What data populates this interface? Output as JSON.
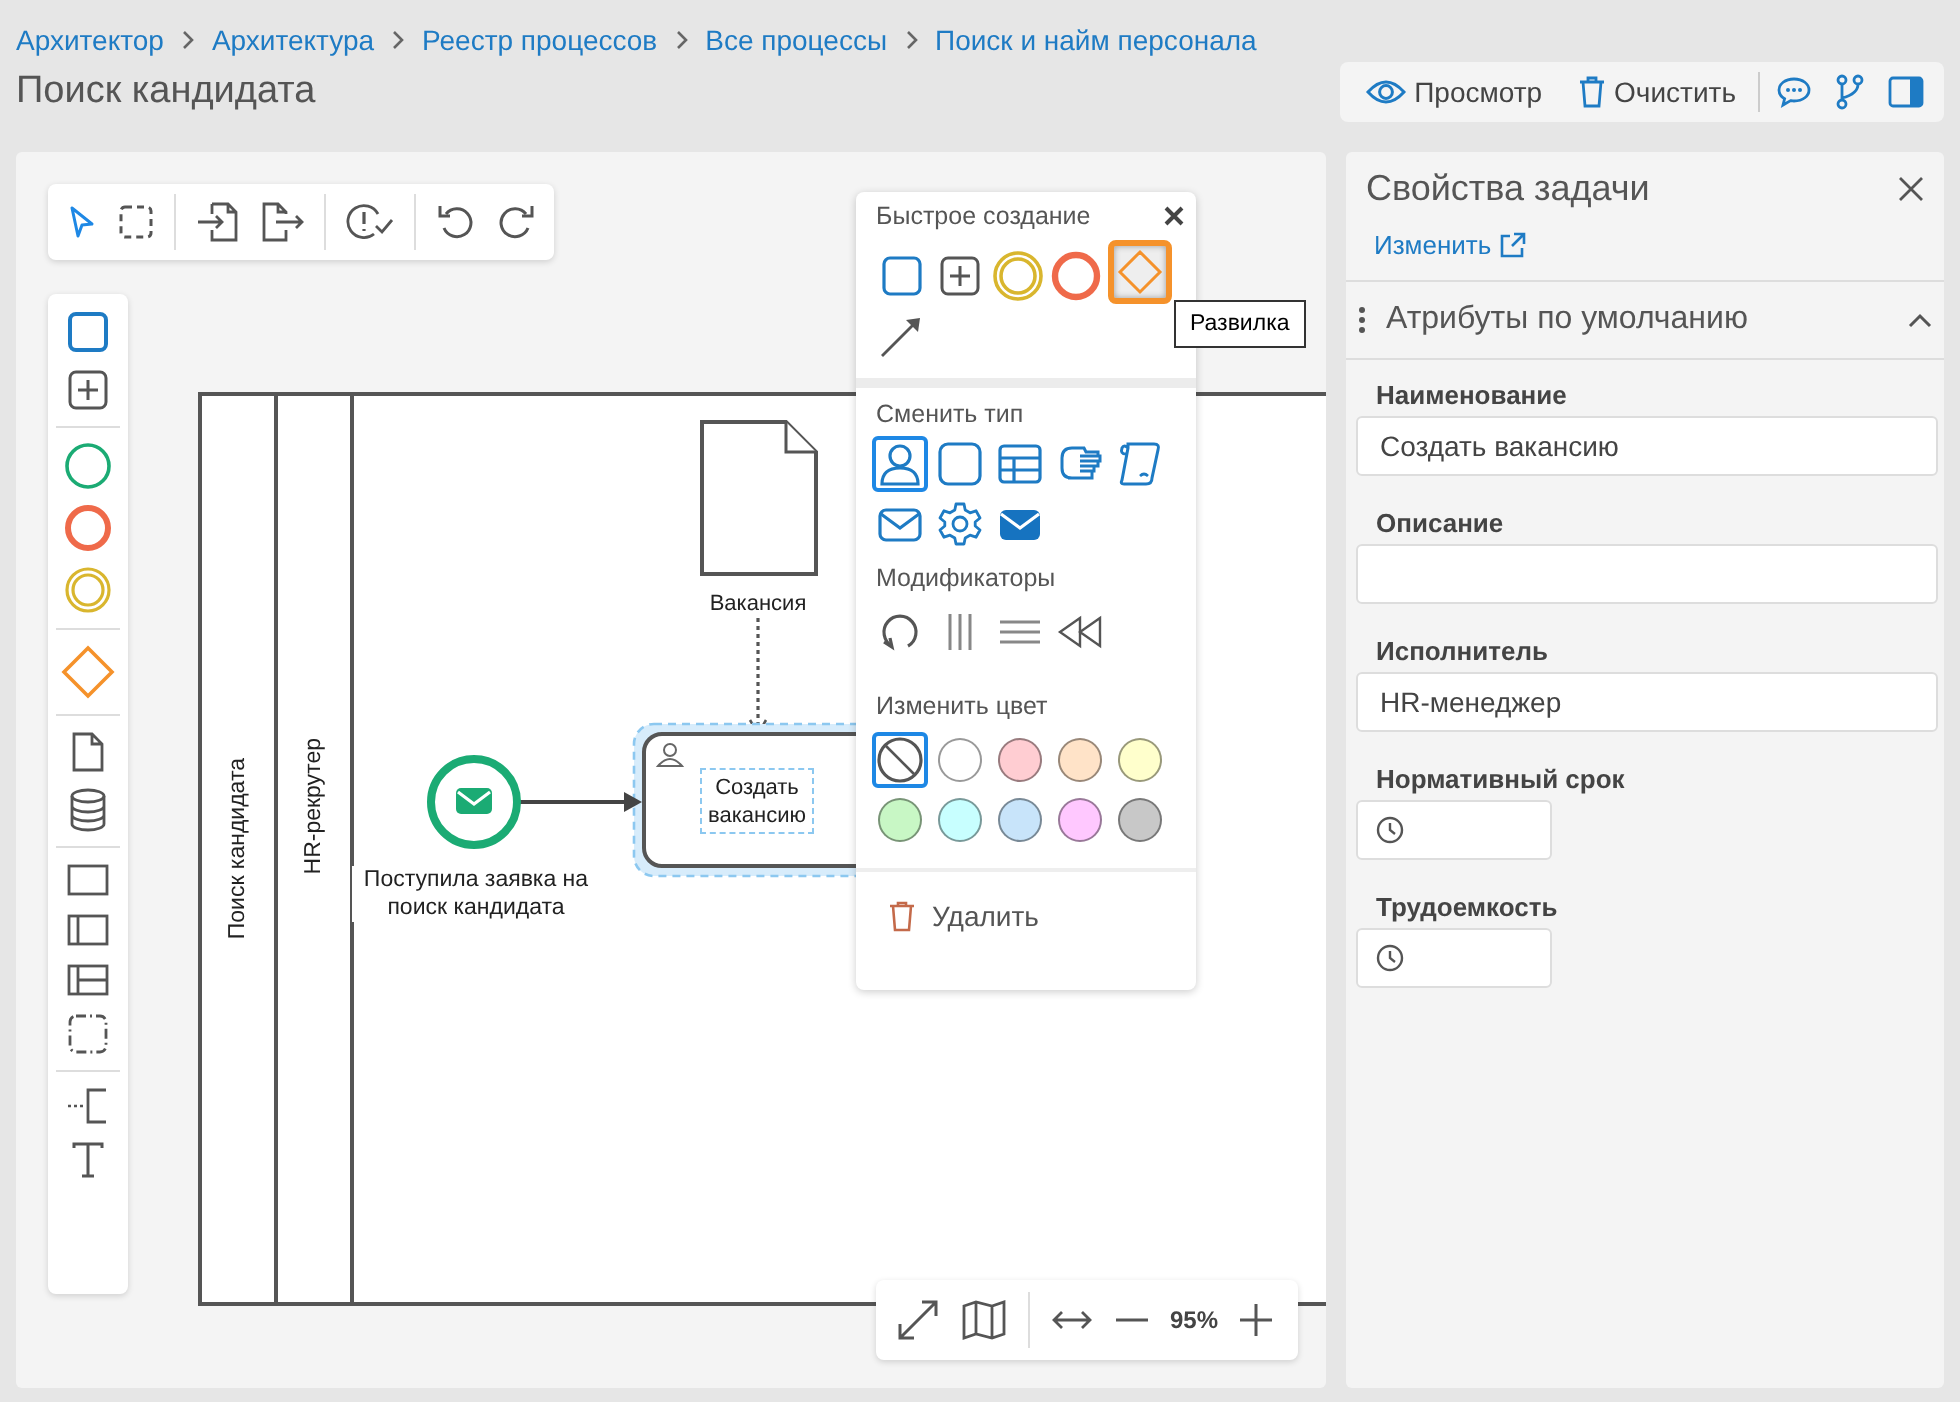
{
  "breadcrumbs": [
    "Архитектор",
    "Архитектура",
    "Реестр процессов",
    "Все процессы",
    "Поиск и найм персонала"
  ],
  "title": "Поиск кандидата",
  "header_actions": [
    {
      "kind": "view",
      "label": "Просмотр"
    },
    {
      "kind": "clear",
      "label": "Очистить"
    },
    {
      "kind": "comments"
    },
    {
      "kind": "branches"
    },
    {
      "kind": "panel"
    }
  ],
  "diagram": {
    "lanes": [
      "Поиск кандидата",
      "HR-рекрутер"
    ],
    "start_event": {
      "label": "Поступила заявка на поиск кандидата"
    },
    "data_object": {
      "label": "Вакансия"
    },
    "task": {
      "label": "Создать вакансию",
      "selected": true
    }
  },
  "quick_menu": {
    "title": "Быстрое создание",
    "create_items": [
      {
        "kind": "task",
        "selected": false
      },
      {
        "kind": "subprocess",
        "selected": false
      },
      {
        "kind": "intermediate",
        "selected": false
      },
      {
        "kind": "end",
        "selected": false
      },
      {
        "kind": "gateway",
        "selected": true
      },
      {
        "kind": "connector",
        "selected": false
      }
    ],
    "tooltip": "Развилка",
    "type_title": "Сменить тип",
    "types": [
      {
        "kind": "user",
        "selected": true
      },
      {
        "kind": "plain",
        "selected": false
      },
      {
        "kind": "rule",
        "selected": false
      },
      {
        "kind": "manual",
        "selected": false
      },
      {
        "kind": "script",
        "selected": false
      },
      {
        "kind": "receive",
        "selected": false
      },
      {
        "kind": "service",
        "selected": false
      },
      {
        "kind": "send",
        "selected": false
      }
    ],
    "modifiers_title": "Модификаторы",
    "modifiers": [
      {
        "kind": "loop"
      },
      {
        "kind": "parallel"
      },
      {
        "kind": "sequential"
      },
      {
        "kind": "compensation"
      }
    ],
    "color_title": "Изменить цвет",
    "colors": [
      {
        "kind": "none",
        "selected": true
      },
      {
        "kind": "fill",
        "color": "#ffffff",
        "selected": false
      },
      {
        "kind": "fill",
        "color": "#ffcdd2",
        "selected": false
      },
      {
        "kind": "fill",
        "color": "#ffe3c8",
        "selected": false
      },
      {
        "kind": "fill",
        "color": "#ffffcc",
        "selected": false
      },
      {
        "kind": "fill",
        "color": "#c8f7c5",
        "selected": false
      },
      {
        "kind": "fill",
        "color": "#c8ffff",
        "selected": false
      },
      {
        "kind": "fill",
        "color": "#c8e4fa",
        "selected": false
      },
      {
        "kind": "fill",
        "color": "#ffc8ff",
        "selected": false
      },
      {
        "kind": "fill",
        "color": "#c8c8c8",
        "selected": false
      }
    ],
    "delete_label": "Удалить"
  },
  "zoom": "95%",
  "properties": {
    "title": "Свойства задачи",
    "edit_link": "Изменить",
    "section": {
      "title": "Атрибуты по умолчанию",
      "expanded": true
    },
    "fields": [
      {
        "kind": "text",
        "label": "Наименование",
        "value": "Создать вакансию"
      },
      {
        "kind": "text",
        "label": "Описание"
      },
      {
        "kind": "text",
        "label": "Исполнитель",
        "value": "HR-менеджер"
      },
      {
        "kind": "duration",
        "label": "Нормативный срок"
      },
      {
        "kind": "duration",
        "label": "Трудоемкость"
      }
    ]
  }
}
